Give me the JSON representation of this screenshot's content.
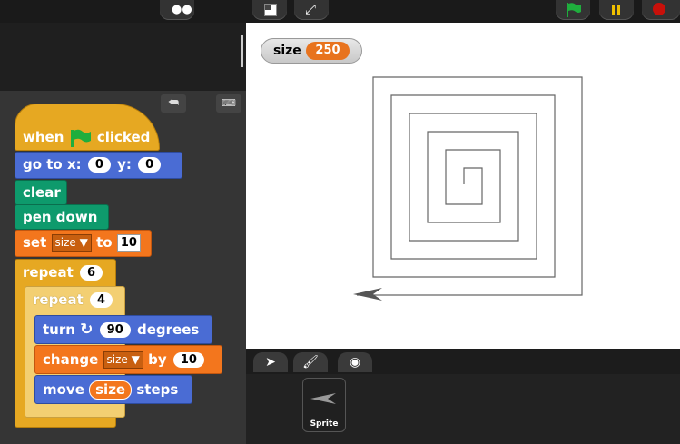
{
  "topbar": {
    "buttons": [
      {
        "name": "logo",
        "icon": "footprints-icon"
      },
      {
        "name": "stage-size",
        "icon": "stage-size-icon"
      },
      {
        "name": "fullscreen",
        "icon": "fullscreen-icon"
      },
      {
        "name": "green-flag",
        "icon": "green-flag-icon",
        "color": "#1fae3d"
      },
      {
        "name": "pause",
        "icon": "pause-icon",
        "color": "#f0c000"
      },
      {
        "name": "stop",
        "icon": "stop-icon",
        "color": "#c8100a"
      }
    ]
  },
  "script": {
    "hat": {
      "when": "when",
      "clicked": "clicked"
    },
    "goto": {
      "label": "go to x:",
      "x": "0",
      "ylabel": "y:",
      "y": "0"
    },
    "clear": "clear",
    "pen_down": "pen down",
    "set": {
      "label": "set",
      "var": "size",
      "to": "to",
      "value": "10"
    },
    "repeat_outer": {
      "label": "repeat",
      "count": "6"
    },
    "repeat_inner": {
      "label": "repeat",
      "count": "4"
    },
    "turn": {
      "label": "turn",
      "degrees": "90",
      "suffix": "degrees"
    },
    "change": {
      "label": "change",
      "var": "size",
      "by": "by",
      "value": "10"
    },
    "move": {
      "label": "move",
      "var": "size",
      "suffix": "steps"
    }
  },
  "watcher": {
    "label": "size",
    "value": "250"
  },
  "stage_tabs": [
    {
      "name": "turtle-tab",
      "icon": "arrow-icon"
    },
    {
      "name": "paintbrush-tab",
      "icon": "paintbrush-icon"
    },
    {
      "name": "camera-tab",
      "icon": "camera-icon"
    }
  ],
  "sprite": {
    "name": "Sprite"
  }
}
